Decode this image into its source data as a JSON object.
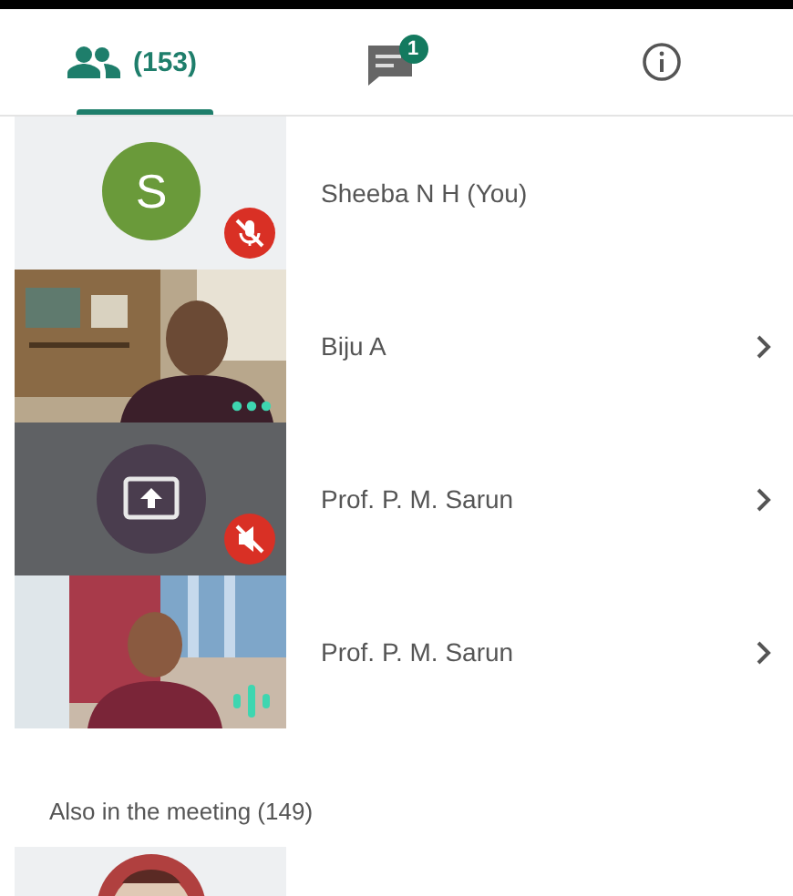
{
  "tabs": [
    {
      "kind": "people",
      "label": "(153)",
      "selected": true
    },
    {
      "kind": "chat",
      "badge": "1",
      "selected": false
    },
    {
      "kind": "info",
      "selected": false
    }
  ],
  "participants": [
    {
      "kind": "avatar",
      "initial": "S",
      "color": "#6a9a3a",
      "name": "Sheeba N H (You)",
      "muted": true,
      "expandable": false
    },
    {
      "kind": "video",
      "name": "Biju A",
      "muted": false,
      "speaking": false,
      "expandable": true
    },
    {
      "kind": "screenshare",
      "name": "Prof. P. M. Sarun",
      "muted": true,
      "expandable": true
    },
    {
      "kind": "video",
      "name": "Prof. P. M. Sarun",
      "muted": false,
      "speaking": true,
      "expandable": true
    }
  ],
  "also_in_meeting": {
    "heading": "Also in the meeting (149)"
  }
}
